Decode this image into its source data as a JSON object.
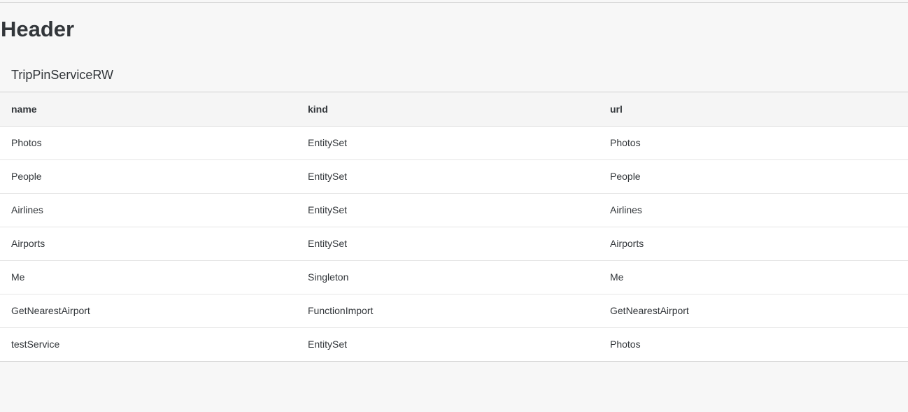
{
  "page": {
    "header": "Header"
  },
  "table": {
    "title": "TripPinServiceRW",
    "columns": [
      "name",
      "kind",
      "url"
    ],
    "rows": [
      {
        "name": "Photos",
        "kind": "EntitySet",
        "url": "Photos"
      },
      {
        "name": "People",
        "kind": "EntitySet",
        "url": "People"
      },
      {
        "name": "Airlines",
        "kind": "EntitySet",
        "url": "Airlines"
      },
      {
        "name": "Airports",
        "kind": "EntitySet",
        "url": "Airports"
      },
      {
        "name": "Me",
        "kind": "Singleton",
        "url": "Me"
      },
      {
        "name": "GetNearestAirport",
        "kind": "FunctionImport",
        "url": "GetNearestAirport"
      },
      {
        "name": "testService",
        "kind": "EntitySet",
        "url": "Photos"
      }
    ]
  }
}
